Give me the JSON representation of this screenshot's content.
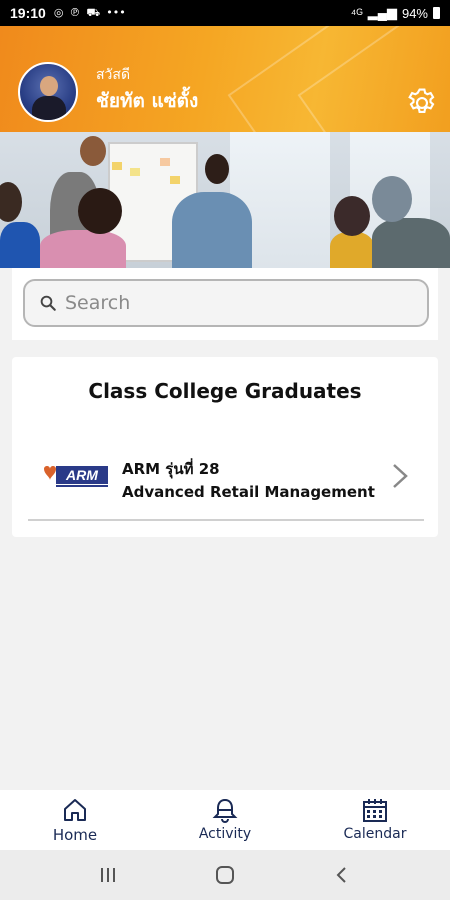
{
  "status_bar": {
    "time": "19:10",
    "icons": [
      "whatsapp-icon",
      "pinterest-icon",
      "car-icon",
      "more-icon"
    ],
    "battery": "94%"
  },
  "header": {
    "greeting": "สวัสดี",
    "user_name": "ชัยทัต   แซ่ตั้ง",
    "accent_color": "#f5a623"
  },
  "search": {
    "placeholder": "Search"
  },
  "class_card": {
    "title": "Class College Graduates",
    "courses": [
      {
        "logo_text": "ARM",
        "line1": "ARM รุ่นที่ 28",
        "line2": "Advanced Retail Management"
      }
    ]
  },
  "bottom_nav": {
    "items": [
      {
        "label": "Home",
        "icon": "home-icon",
        "active": true
      },
      {
        "label": "Activity",
        "icon": "bell-icon",
        "active": false
      },
      {
        "label": "Calendar",
        "icon": "calendar-icon",
        "active": false
      }
    ]
  },
  "colors": {
    "nav_text": "#1a2a55",
    "header_orange": "#f08a1c"
  }
}
